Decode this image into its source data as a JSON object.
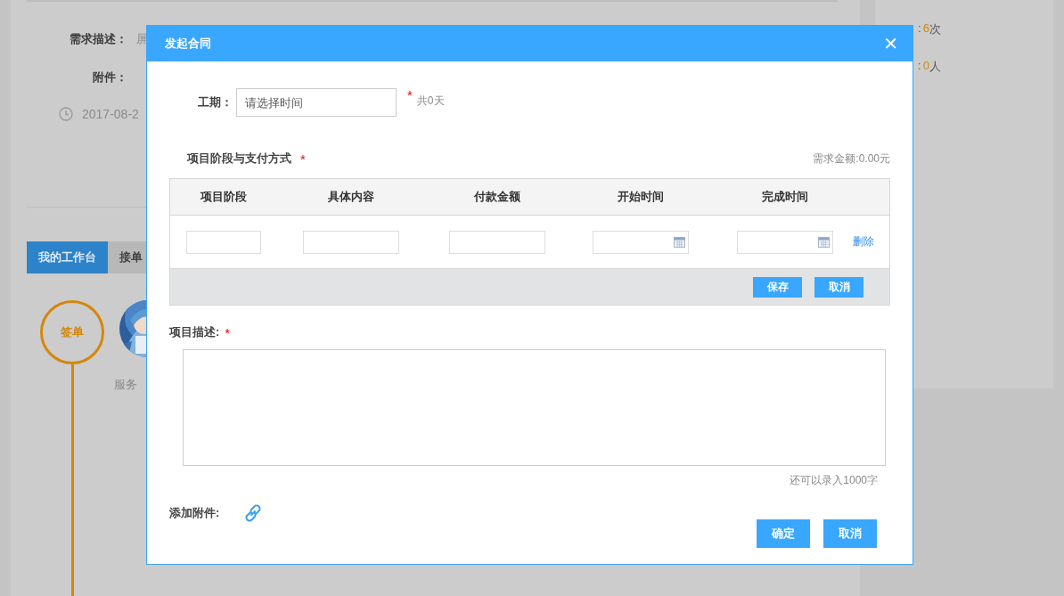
{
  "background_page": {
    "details": [
      {
        "label": "需求描述：",
        "value": "屏"
      },
      {
        "label": "附件："
      }
    ],
    "date": "2017-08-2",
    "tabs": [
      {
        "label": "我的工作台",
        "selected": true
      },
      {
        "label": "接单",
        "selected": false
      }
    ],
    "timeline": {
      "step": "签单",
      "caption": "服务"
    },
    "stats": [
      {
        "label": ":",
        "count": "6",
        "unit": "次"
      },
      {
        "label": ":",
        "count": "0",
        "unit": "人"
      }
    ]
  },
  "dialog": {
    "title": "发起合同",
    "close": "✕",
    "duration": {
      "label": "工期：",
      "placeholder": "请选择时间",
      "required_mark": "*",
      "note": "共0天"
    },
    "stages": {
      "title": "项目阶段与支付方式",
      "required_mark": "*",
      "amount": "需求金额:0.00元",
      "columns": [
        "项目阶段",
        "具体内容",
        "付款金额",
        "开始时间",
        "完成时间"
      ],
      "rows": [
        {
          "cells": [
            {
              "kind": "text"
            },
            {
              "kind": "text"
            },
            {
              "kind": "text"
            },
            {
              "kind": "date"
            },
            {
              "kind": "date"
            }
          ],
          "action": "删除"
        }
      ],
      "buttons": [
        "保存",
        "取消"
      ]
    },
    "description": {
      "label": "项目描述:",
      "required_mark": "*",
      "counter": "还可以录入1000字"
    },
    "attachment": {
      "label": "添加附件:"
    },
    "buttons": [
      "确定",
      "取消"
    ]
  }
}
